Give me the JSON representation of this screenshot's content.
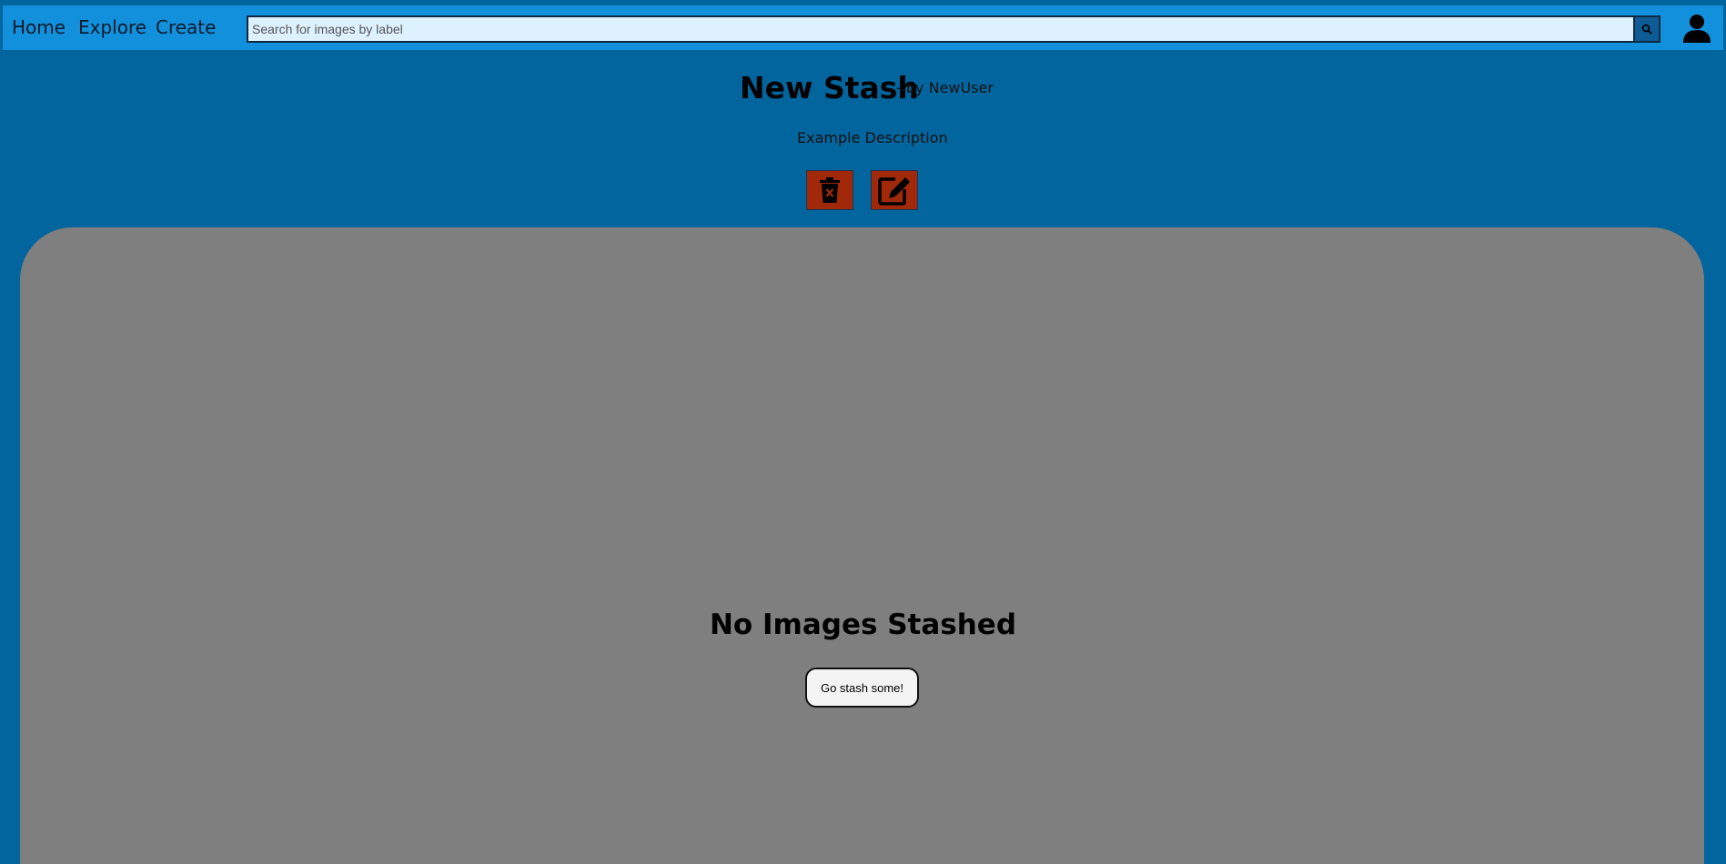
{
  "navbar": {
    "links": [
      {
        "label": "Home"
      },
      {
        "label": "Explore"
      },
      {
        "label": "Create"
      }
    ],
    "search": {
      "placeholder": "Search for images by label",
      "value": "",
      "button_icon": "search-icon"
    },
    "profile_icon": "user-icon",
    "colors": {
      "bar": "#1290dc",
      "search_bg": "#ddf1ff",
      "search_button": "#0d5c96"
    }
  },
  "stash": {
    "title": "New Stash",
    "byline": "- by NewUser",
    "description": "Example Description",
    "actions": [
      {
        "icon": "trash-icon"
      },
      {
        "icon": "edit-icon"
      }
    ],
    "action_color": "#a1290a"
  },
  "gallery": {
    "empty_heading": "No Images Stashed",
    "cta_label": "Go stash some!",
    "background": "#7f7f7f"
  },
  "page": {
    "background": "#02659e"
  }
}
